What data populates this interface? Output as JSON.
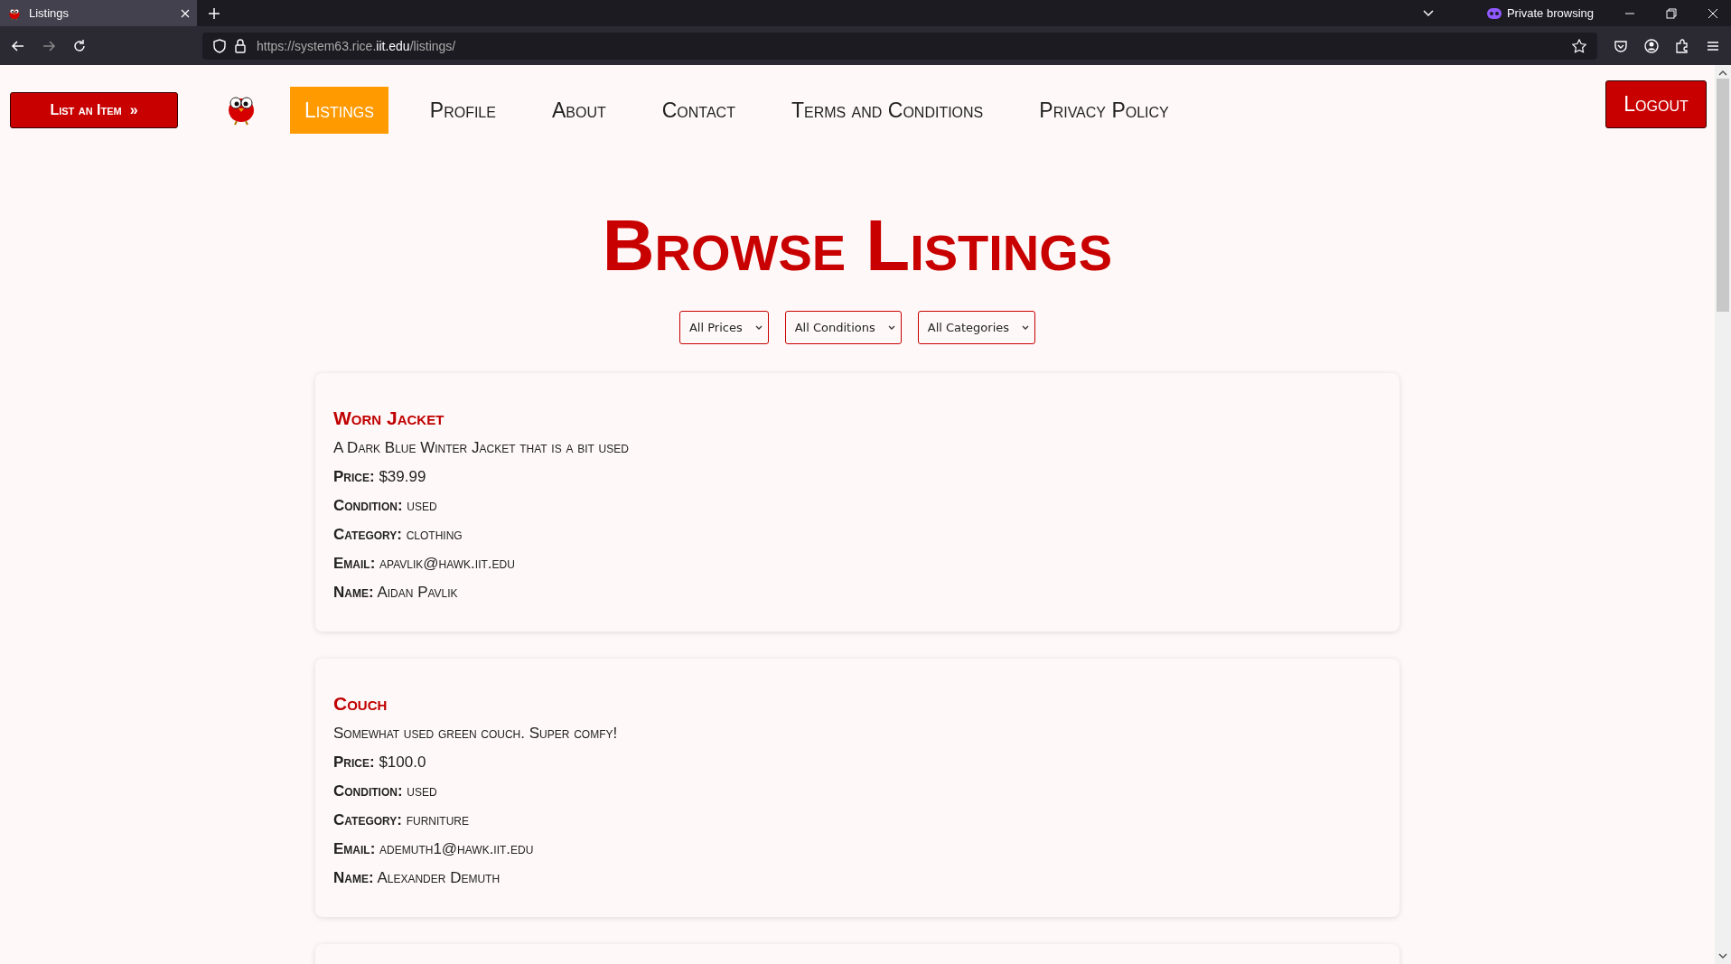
{
  "browser": {
    "tab_title": "Listings",
    "url_prefix": "https://system63.rice.",
    "url_domain": "iit.edu",
    "url_path": "/listings/",
    "private_label": "Private browsing"
  },
  "nav": {
    "list_button": "List an Item  »",
    "items": [
      {
        "label": "Listings",
        "selected": true
      },
      {
        "label": "Profile",
        "selected": false
      },
      {
        "label": "About",
        "selected": false
      },
      {
        "label": "Contact",
        "selected": false
      },
      {
        "label": "Terms and Conditions",
        "selected": false
      },
      {
        "label": "Privacy Policy",
        "selected": false
      }
    ],
    "logout": "Logout"
  },
  "heading": "Browse Listings",
  "filters": [
    {
      "value": "All Prices"
    },
    {
      "value": "All Conditions"
    },
    {
      "value": "All Categories"
    }
  ],
  "listings": [
    {
      "title": "Worn Jacket",
      "description": "A Dark Blue Winter Jacket that is a bit used",
      "fields": [
        "**Price:** $39.99",
        "**Condition:** used",
        "**Category:** clothing",
        "**Email:** apavlik@hawk.iit.edu",
        "**Name:** Aidan Pavlik"
      ]
    },
    {
      "title": "Couch",
      "description": "Somewhat used green couch. Super comfy!",
      "fields": [
        "**Price:** $100.0",
        "**Condition:** used",
        "**Category:** furniture",
        "**Email:** ademuth1@hawk.iit.edu",
        "**Name:** Alexander Demuth"
      ]
    }
  ]
}
